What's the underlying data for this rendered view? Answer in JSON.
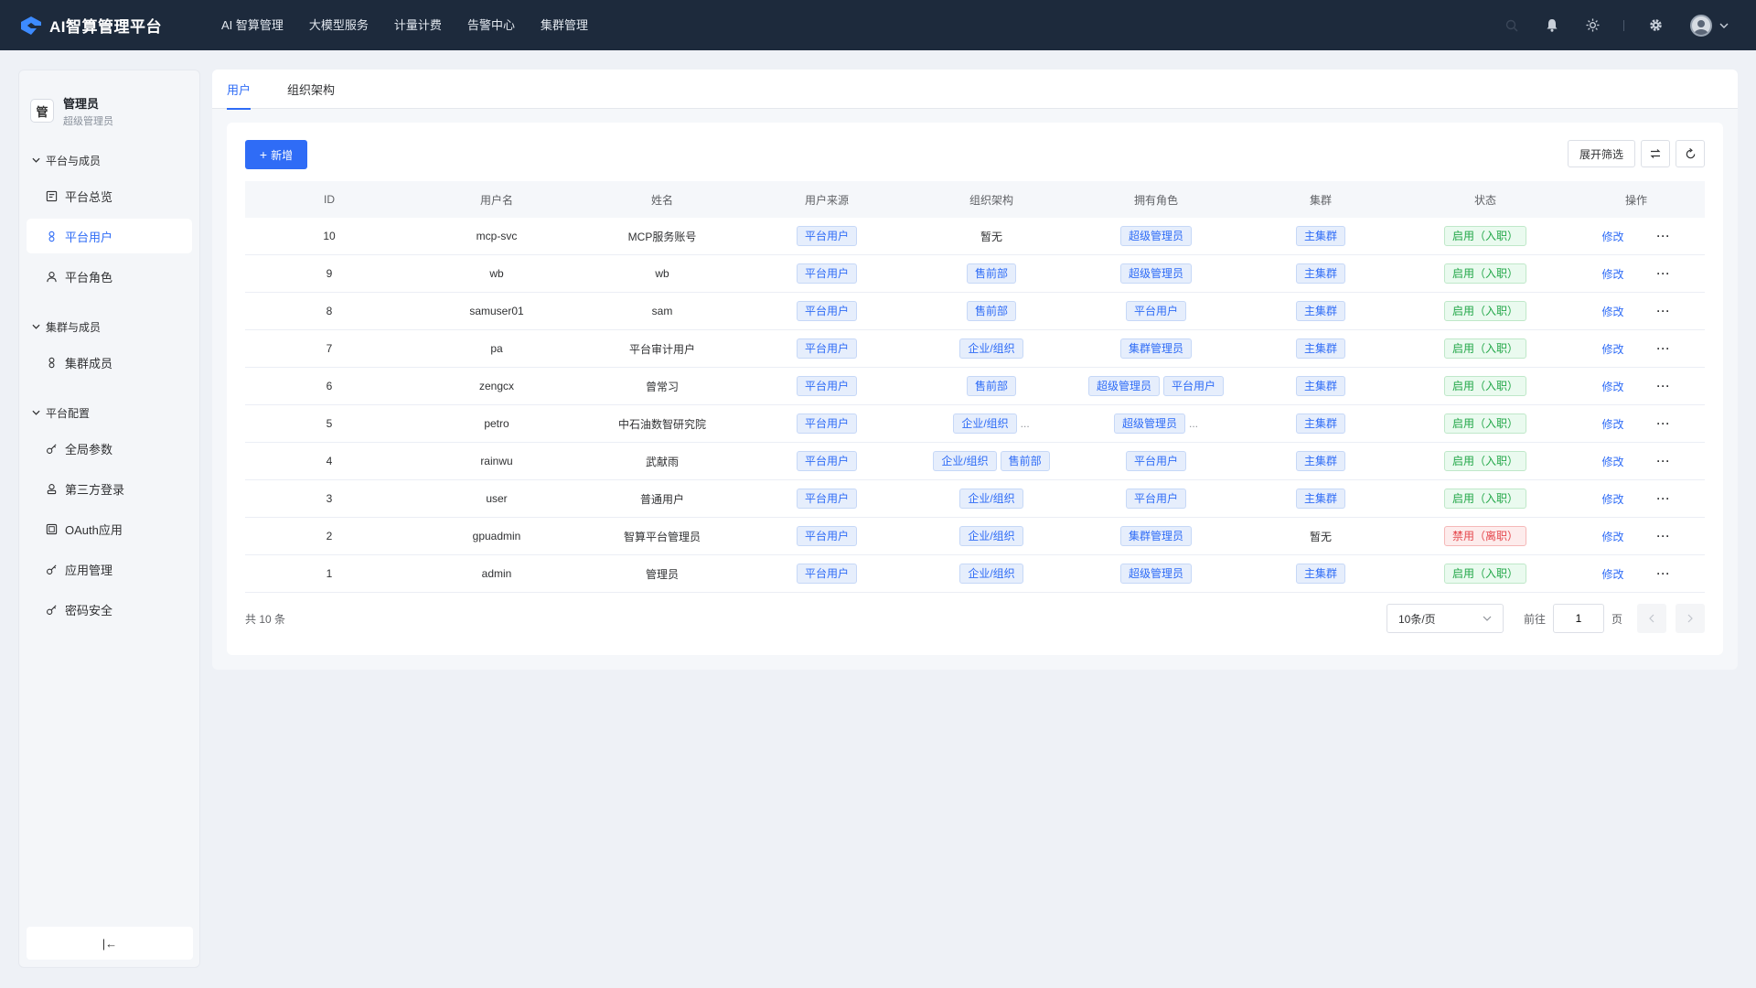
{
  "app": {
    "title": "AI智算管理平台",
    "nav": [
      "AI 智算管理",
      "大模型服务",
      "计量计费",
      "告警中心",
      "集群管理"
    ]
  },
  "sidebar": {
    "user_initial": "管",
    "user_name": "管理员",
    "user_role": "超级管理员",
    "groups": [
      {
        "title": "平台与成员",
        "items": [
          {
            "label": "平台总览",
            "icon": "dashboard-icon"
          },
          {
            "label": "平台用户",
            "icon": "users-icon",
            "active": true
          },
          {
            "label": "平台角色",
            "icon": "user-icon"
          }
        ]
      },
      {
        "title": "集群与成员",
        "items": [
          {
            "label": "集群成员",
            "icon": "users-icon"
          }
        ]
      },
      {
        "title": "平台配置",
        "items": [
          {
            "label": "全局参数",
            "icon": "key-icon"
          },
          {
            "label": "第三方登录",
            "icon": "login-icon"
          },
          {
            "label": "OAuth应用",
            "icon": "app-icon"
          },
          {
            "label": "应用管理",
            "icon": "key-icon"
          },
          {
            "label": "密码安全",
            "icon": "key-icon"
          }
        ]
      }
    ],
    "collapse_label": "|←"
  },
  "tabs": [
    "用户",
    "组织架构"
  ],
  "toolbar": {
    "add_label": "新增",
    "filter_label": "展开筛选"
  },
  "table": {
    "headers": [
      "ID",
      "用户名",
      "姓名",
      "用户来源",
      "组织架构",
      "拥有角色",
      "集群",
      "状态",
      "操作"
    ],
    "edit_label": "修改",
    "rows": [
      {
        "id": "10",
        "username": "mcp-svc",
        "name": "MCP服务账号",
        "source": "平台用户",
        "org": [],
        "org_text": "暂无",
        "org_more": false,
        "roles": [
          "超级管理员"
        ],
        "roles_more": false,
        "cluster": "主集群",
        "status": "启用（入职）",
        "status_ok": true
      },
      {
        "id": "9",
        "username": "wb",
        "name": "wb",
        "source": "平台用户",
        "org": [
          "售前部"
        ],
        "org_more": false,
        "roles": [
          "超级管理员"
        ],
        "roles_more": false,
        "cluster": "主集群",
        "status": "启用（入职）",
        "status_ok": true
      },
      {
        "id": "8",
        "username": "samuser01",
        "name": "sam",
        "source": "平台用户",
        "org": [
          "售前部"
        ],
        "org_more": false,
        "roles": [
          "平台用户"
        ],
        "roles_more": false,
        "cluster": "主集群",
        "status": "启用（入职）",
        "status_ok": true
      },
      {
        "id": "7",
        "username": "pa",
        "name": "平台审计用户",
        "source": "平台用户",
        "org": [
          "企业/组织"
        ],
        "org_more": false,
        "roles": [
          "集群管理员"
        ],
        "roles_more": false,
        "cluster": "主集群",
        "status": "启用（入职）",
        "status_ok": true
      },
      {
        "id": "6",
        "username": "zengcx",
        "name": "曾常习",
        "source": "平台用户",
        "org": [
          "售前部"
        ],
        "org_more": false,
        "roles": [
          "超级管理员",
          "平台用户"
        ],
        "roles_more": false,
        "cluster": "主集群",
        "status": "启用（入职）",
        "status_ok": true
      },
      {
        "id": "5",
        "username": "petro",
        "name": "中石油数智研究院",
        "source": "平台用户",
        "org": [
          "企业/组织"
        ],
        "org_more": true,
        "roles": [
          "超级管理员"
        ],
        "roles_more": true,
        "cluster": "主集群",
        "status": "启用（入职）",
        "status_ok": true
      },
      {
        "id": "4",
        "username": "rainwu",
        "name": "武献雨",
        "source": "平台用户",
        "org": [
          "企业/组织",
          "售前部"
        ],
        "org_more": false,
        "roles": [
          "平台用户"
        ],
        "roles_more": false,
        "cluster": "主集群",
        "status": "启用（入职）",
        "status_ok": true
      },
      {
        "id": "3",
        "username": "user",
        "name": "普通用户",
        "source": "平台用户",
        "org": [
          "企业/组织"
        ],
        "org_more": false,
        "roles": [
          "平台用户"
        ],
        "roles_more": false,
        "cluster": "主集群",
        "status": "启用（入职）",
        "status_ok": true
      },
      {
        "id": "2",
        "username": "gpuadmin",
        "name": "智算平台管理员",
        "source": "平台用户",
        "org": [
          "企业/组织"
        ],
        "org_more": false,
        "roles": [
          "集群管理员"
        ],
        "roles_more": false,
        "cluster": "",
        "cluster_text": "暂无",
        "status": "禁用（离职）",
        "status_ok": false
      },
      {
        "id": "1",
        "username": "admin",
        "name": "管理员",
        "source": "平台用户",
        "org": [
          "企业/组织"
        ],
        "org_more": false,
        "roles": [
          "超级管理员"
        ],
        "roles_more": false,
        "cluster": "主集群",
        "status": "启用（入职）",
        "status_ok": true
      }
    ]
  },
  "pagination": {
    "total": "共 10 条",
    "page_size": "10条/页",
    "goto_label": "前往",
    "current_page": "1",
    "page_suffix": "页"
  },
  "colors": {
    "topbar": "#1d2a3c",
    "accent": "#2f6cf6",
    "ok": "#22a748",
    "danger": "#e5484d"
  }
}
